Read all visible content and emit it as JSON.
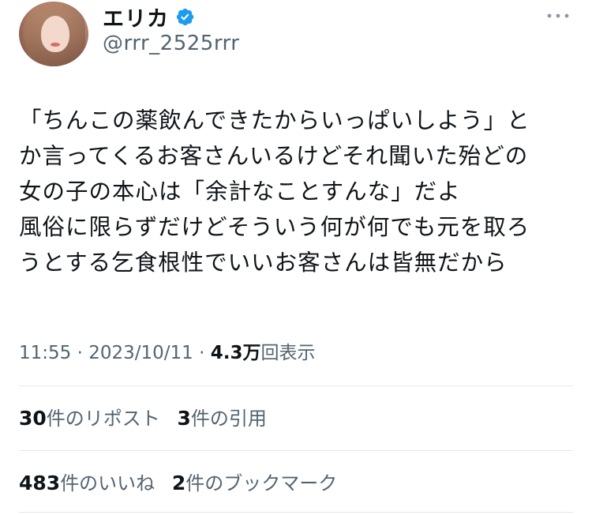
{
  "user": {
    "name": "エリカ",
    "handle": "@rrr_2525rrr"
  },
  "tweet": {
    "lines": [
      "「ちんこの薬飲んできたからいっぱいしよう」と",
      "か言ってくるお客さんいるけどそれ聞いた殆どの",
      "女の子の本心は「余計なことすんな」だよ",
      "風俗に限らずだけどそういう何が何でも元を取ろ",
      "うとする乞食根性でいいお客さんは皆無だから"
    ]
  },
  "meta": {
    "time": "11:55",
    "separator": " · ",
    "date": "2023/10/11",
    "views_count": "4.3万",
    "views_label": "回表示"
  },
  "stats": {
    "reposts_count": "30",
    "reposts_label": "件のリポスト",
    "quotes_count": "3",
    "quotes_label": "件の引用",
    "likes_count": "483",
    "likes_label": "件のいいね",
    "bookmarks_count": "2",
    "bookmarks_label": "件のブックマーク"
  },
  "icons": {
    "verified": "verified-badge-icon",
    "more": "more-options-icon"
  },
  "colors": {
    "verified": "#1d9bf0",
    "secondary_text": "#536471",
    "primary_text": "#0f1419",
    "divider": "#e1e8ed"
  }
}
